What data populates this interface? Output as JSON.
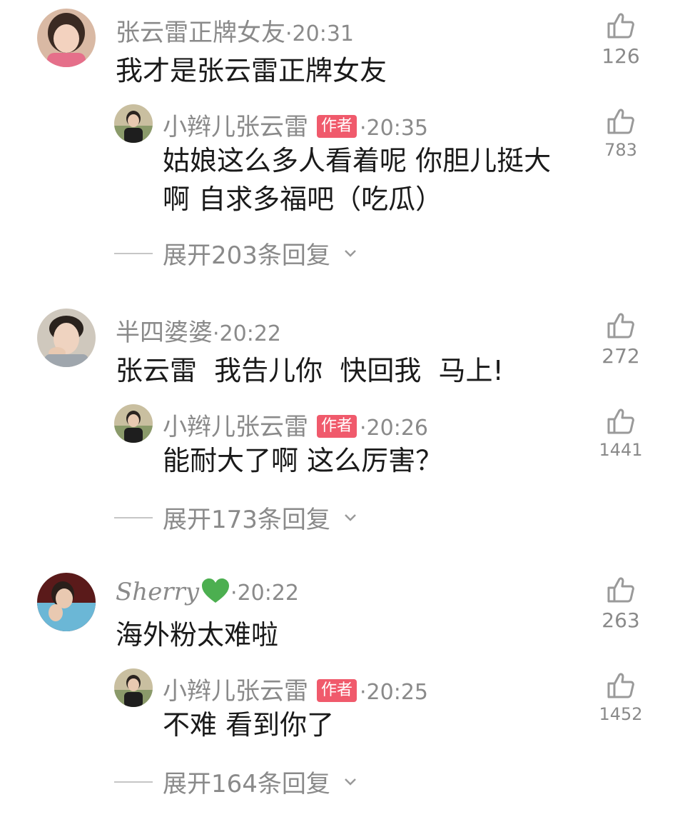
{
  "threads": [
    {
      "user": "张云雷正牌女友",
      "time": "·20:31",
      "text": "我才是张云雷正牌女友",
      "likes": "126",
      "reply": {
        "user": "小辫儿张云雷",
        "badge": "作者",
        "time": "·20:35",
        "text": "姑娘这么多人看着呢 你胆儿挺大啊 自求多福吧（吃瓜）",
        "likes": "783"
      },
      "expand": "展开203条回复"
    },
    {
      "user": "半四婆婆",
      "time": "·20:22",
      "text": "张云雷  我告儿你  快回我  马上!",
      "likes": "272",
      "reply": {
        "user": "小辫儿张云雷",
        "badge": "作者",
        "time": "·20:26",
        "text": "能耐大了啊 这么厉害？",
        "likes": "1441"
      },
      "expand": "展开173条回复"
    },
    {
      "user": "Sherry",
      "time": "·20:22",
      "text": "海外粉太难啦",
      "likes": "263",
      "reply": {
        "user": "小辫儿张云雷",
        "badge": "作者",
        "time": "·20:25",
        "text": "不难 看到你了",
        "likes": "1452"
      },
      "expand": "展开164条回复"
    }
  ],
  "icons": {
    "like": "thumbs-up-icon",
    "expand": "chevron-down-icon",
    "heart": "green-heart-emoji"
  },
  "colors": {
    "badge": "#f05a6c",
    "meta": "#8a8a8a",
    "heart": "#4caf50"
  }
}
